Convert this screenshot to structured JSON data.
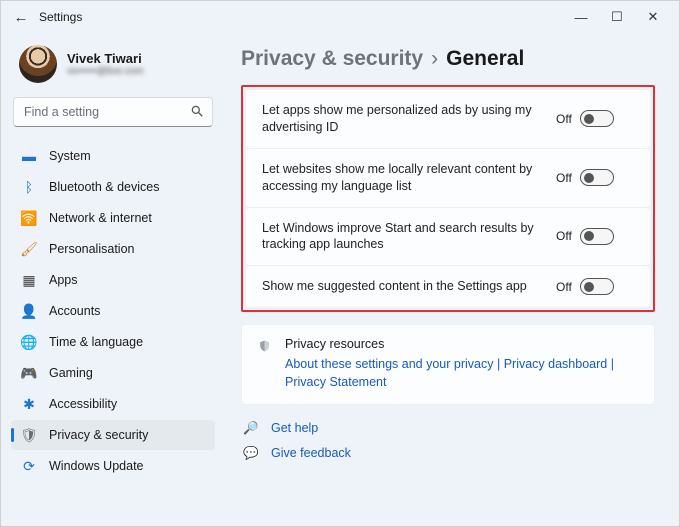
{
  "titlebar": {
    "title": "Settings"
  },
  "user": {
    "name": "Vivek Tiwari",
    "email_masked": "viv•••••@live.com"
  },
  "search": {
    "placeholder": "Find a setting"
  },
  "nav": {
    "items": [
      {
        "label": "System",
        "icon_name": "system-icon"
      },
      {
        "label": "Bluetooth & devices",
        "icon_name": "bluetooth-icon"
      },
      {
        "label": "Network & internet",
        "icon_name": "network-icon"
      },
      {
        "label": "Personalisation",
        "icon_name": "personalisation-icon"
      },
      {
        "label": "Apps",
        "icon_name": "apps-icon"
      },
      {
        "label": "Accounts",
        "icon_name": "accounts-icon"
      },
      {
        "label": "Time & language",
        "icon_name": "time-language-icon"
      },
      {
        "label": "Gaming",
        "icon_name": "gaming-icon"
      },
      {
        "label": "Accessibility",
        "icon_name": "accessibility-icon"
      },
      {
        "label": "Privacy & security",
        "icon_name": "privacy-icon",
        "active": true
      },
      {
        "label": "Windows Update",
        "icon_name": "update-icon"
      }
    ]
  },
  "breadcrumb": {
    "parent": "Privacy & security",
    "sep": "›",
    "current": "General"
  },
  "toggles": [
    {
      "desc": "Let apps show me personalized ads by using my advertising ID",
      "state": "Off"
    },
    {
      "desc": "Let websites show me locally relevant content by accessing my language list",
      "state": "Off"
    },
    {
      "desc": "Let Windows improve Start and search results by tracking app launches",
      "state": "Off"
    },
    {
      "desc": "Show me suggested content in the Settings app",
      "state": "Off"
    }
  ],
  "resources": {
    "title": "Privacy resources",
    "links": [
      "About these settings and your privacy",
      "Privacy dashboard",
      "Privacy Statement"
    ],
    "sep": " | "
  },
  "footer": {
    "help": "Get help",
    "feedback": "Give feedback"
  }
}
